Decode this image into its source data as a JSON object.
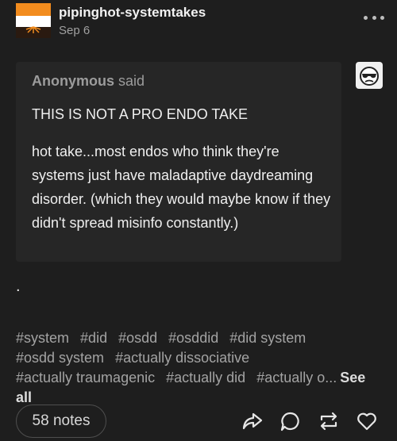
{
  "header": {
    "blog_name": "pipinghot-systemtakes",
    "date": "Sep 6",
    "more_icon": "ellipsis-icon"
  },
  "ask": {
    "asker_name": "Anonymous",
    "asker_verb": "said",
    "heading": "THIS IS NOT A PRO ENDO TAKE",
    "body": "hot take...most endos who think they're systems just have maladaptive daydreaming disorder. (which they would maybe know if they didn't spread misinfo constantly.)",
    "asker_avatar_icon": "anonymous-sunglasses-icon"
  },
  "answer": {
    "text": "."
  },
  "tags": {
    "items": [
      "#system",
      "#did",
      "#osdd",
      "#osddid",
      "#did system",
      "#osdd system",
      "#actually dissociative",
      "#actually traumagenic",
      "#actually did",
      "#actually o..."
    ],
    "see_all_label": "See all"
  },
  "footer": {
    "notes_label": "58 notes",
    "share_icon": "share-icon",
    "reply_icon": "reply-icon",
    "reblog_icon": "reblog-icon",
    "like_icon": "heart-icon"
  },
  "colors": {
    "background": "#1e1e1e",
    "ask_box": "#262626",
    "tag_text": "#a3a3a3",
    "avatar_orange": "#f28c1e"
  }
}
